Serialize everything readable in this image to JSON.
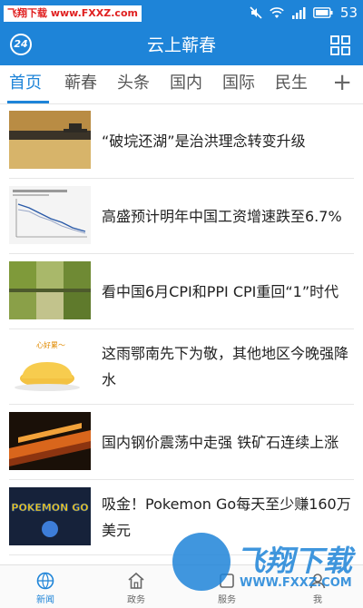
{
  "watermark": {
    "top_left": "飞翔下载 www.FXXZ.com",
    "brand": "飞翔下载",
    "url": "WWW.FXXZ.COM"
  },
  "status_bar": {
    "time": "53",
    "icons": [
      "mute-icon",
      "wifi-icon",
      "signal-icon",
      "battery-icon"
    ]
  },
  "app_bar": {
    "logo_text": "24",
    "title": "云上蕲春",
    "menu_icon": "grid-icon"
  },
  "tabs": {
    "items": [
      {
        "label": "首页",
        "active": true
      },
      {
        "label": "蕲春",
        "active": false
      },
      {
        "label": "头条",
        "active": false
      },
      {
        "label": "国内",
        "active": false
      },
      {
        "label": "国际",
        "active": false
      },
      {
        "label": "民生",
        "active": false
      }
    ],
    "add_label": "+"
  },
  "feed": [
    {
      "title": "“破垸还湖”是治洪理念转变升级"
    },
    {
      "title": "高盛预计明年中国工资增速跌至6.7%"
    },
    {
      "title": "看中国6月CPI和PPI  CPI重回“1”时代"
    },
    {
      "title": "这雨鄂南先下为敬，其他地区今晚强降水",
      "thumb_caption": "心好累～"
    },
    {
      "title": "国内钢价震荡中走强 铁矿石连续上涨"
    },
    {
      "title": "吸金！Pokemon Go每天至少赚160万美元",
      "thumb_caption": "POKEMON GO"
    }
  ],
  "bottom_nav": [
    {
      "label": "新闻",
      "icon": "globe-icon",
      "active": true
    },
    {
      "label": "政务",
      "icon": "home-icon",
      "active": false
    },
    {
      "label": "服务",
      "icon": "service-icon",
      "active": false
    },
    {
      "label": "我",
      "icon": "user-icon",
      "active": false
    }
  ],
  "colors": {
    "primary": "#1e84d8",
    "text": "#222222",
    "tab_inactive": "#555555"
  }
}
